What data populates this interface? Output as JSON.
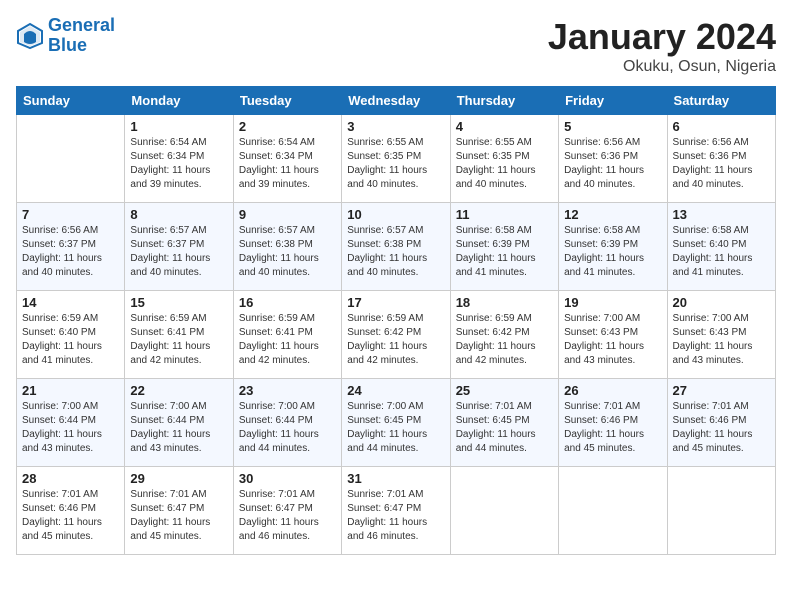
{
  "header": {
    "logo_line1": "General",
    "logo_line2": "Blue",
    "month_year": "January 2024",
    "location": "Okuku, Osun, Nigeria"
  },
  "weekdays": [
    "Sunday",
    "Monday",
    "Tuesday",
    "Wednesday",
    "Thursday",
    "Friday",
    "Saturday"
  ],
  "weeks": [
    [
      {
        "day": "",
        "sunrise": "",
        "sunset": "",
        "daylight": ""
      },
      {
        "day": "1",
        "sunrise": "Sunrise: 6:54 AM",
        "sunset": "Sunset: 6:34 PM",
        "daylight": "Daylight: 11 hours and 39 minutes."
      },
      {
        "day": "2",
        "sunrise": "Sunrise: 6:54 AM",
        "sunset": "Sunset: 6:34 PM",
        "daylight": "Daylight: 11 hours and 39 minutes."
      },
      {
        "day": "3",
        "sunrise": "Sunrise: 6:55 AM",
        "sunset": "Sunset: 6:35 PM",
        "daylight": "Daylight: 11 hours and 40 minutes."
      },
      {
        "day": "4",
        "sunrise": "Sunrise: 6:55 AM",
        "sunset": "Sunset: 6:35 PM",
        "daylight": "Daylight: 11 hours and 40 minutes."
      },
      {
        "day": "5",
        "sunrise": "Sunrise: 6:56 AM",
        "sunset": "Sunset: 6:36 PM",
        "daylight": "Daylight: 11 hours and 40 minutes."
      },
      {
        "day": "6",
        "sunrise": "Sunrise: 6:56 AM",
        "sunset": "Sunset: 6:36 PM",
        "daylight": "Daylight: 11 hours and 40 minutes."
      }
    ],
    [
      {
        "day": "7",
        "sunrise": "Sunrise: 6:56 AM",
        "sunset": "Sunset: 6:37 PM",
        "daylight": "Daylight: 11 hours and 40 minutes."
      },
      {
        "day": "8",
        "sunrise": "Sunrise: 6:57 AM",
        "sunset": "Sunset: 6:37 PM",
        "daylight": "Daylight: 11 hours and 40 minutes."
      },
      {
        "day": "9",
        "sunrise": "Sunrise: 6:57 AM",
        "sunset": "Sunset: 6:38 PM",
        "daylight": "Daylight: 11 hours and 40 minutes."
      },
      {
        "day": "10",
        "sunrise": "Sunrise: 6:57 AM",
        "sunset": "Sunset: 6:38 PM",
        "daylight": "Daylight: 11 hours and 40 minutes."
      },
      {
        "day": "11",
        "sunrise": "Sunrise: 6:58 AM",
        "sunset": "Sunset: 6:39 PM",
        "daylight": "Daylight: 11 hours and 41 minutes."
      },
      {
        "day": "12",
        "sunrise": "Sunrise: 6:58 AM",
        "sunset": "Sunset: 6:39 PM",
        "daylight": "Daylight: 11 hours and 41 minutes."
      },
      {
        "day": "13",
        "sunrise": "Sunrise: 6:58 AM",
        "sunset": "Sunset: 6:40 PM",
        "daylight": "Daylight: 11 hours and 41 minutes."
      }
    ],
    [
      {
        "day": "14",
        "sunrise": "Sunrise: 6:59 AM",
        "sunset": "Sunset: 6:40 PM",
        "daylight": "Daylight: 11 hours and 41 minutes."
      },
      {
        "day": "15",
        "sunrise": "Sunrise: 6:59 AM",
        "sunset": "Sunset: 6:41 PM",
        "daylight": "Daylight: 11 hours and 42 minutes."
      },
      {
        "day": "16",
        "sunrise": "Sunrise: 6:59 AM",
        "sunset": "Sunset: 6:41 PM",
        "daylight": "Daylight: 11 hours and 42 minutes."
      },
      {
        "day": "17",
        "sunrise": "Sunrise: 6:59 AM",
        "sunset": "Sunset: 6:42 PM",
        "daylight": "Daylight: 11 hours and 42 minutes."
      },
      {
        "day": "18",
        "sunrise": "Sunrise: 6:59 AM",
        "sunset": "Sunset: 6:42 PM",
        "daylight": "Daylight: 11 hours and 42 minutes."
      },
      {
        "day": "19",
        "sunrise": "Sunrise: 7:00 AM",
        "sunset": "Sunset: 6:43 PM",
        "daylight": "Daylight: 11 hours and 43 minutes."
      },
      {
        "day": "20",
        "sunrise": "Sunrise: 7:00 AM",
        "sunset": "Sunset: 6:43 PM",
        "daylight": "Daylight: 11 hours and 43 minutes."
      }
    ],
    [
      {
        "day": "21",
        "sunrise": "Sunrise: 7:00 AM",
        "sunset": "Sunset: 6:44 PM",
        "daylight": "Daylight: 11 hours and 43 minutes."
      },
      {
        "day": "22",
        "sunrise": "Sunrise: 7:00 AM",
        "sunset": "Sunset: 6:44 PM",
        "daylight": "Daylight: 11 hours and 43 minutes."
      },
      {
        "day": "23",
        "sunrise": "Sunrise: 7:00 AM",
        "sunset": "Sunset: 6:44 PM",
        "daylight": "Daylight: 11 hours and 44 minutes."
      },
      {
        "day": "24",
        "sunrise": "Sunrise: 7:00 AM",
        "sunset": "Sunset: 6:45 PM",
        "daylight": "Daylight: 11 hours and 44 minutes."
      },
      {
        "day": "25",
        "sunrise": "Sunrise: 7:01 AM",
        "sunset": "Sunset: 6:45 PM",
        "daylight": "Daylight: 11 hours and 44 minutes."
      },
      {
        "day": "26",
        "sunrise": "Sunrise: 7:01 AM",
        "sunset": "Sunset: 6:46 PM",
        "daylight": "Daylight: 11 hours and 45 minutes."
      },
      {
        "day": "27",
        "sunrise": "Sunrise: 7:01 AM",
        "sunset": "Sunset: 6:46 PM",
        "daylight": "Daylight: 11 hours and 45 minutes."
      }
    ],
    [
      {
        "day": "28",
        "sunrise": "Sunrise: 7:01 AM",
        "sunset": "Sunset: 6:46 PM",
        "daylight": "Daylight: 11 hours and 45 minutes."
      },
      {
        "day": "29",
        "sunrise": "Sunrise: 7:01 AM",
        "sunset": "Sunset: 6:47 PM",
        "daylight": "Daylight: 11 hours and 45 minutes."
      },
      {
        "day": "30",
        "sunrise": "Sunrise: 7:01 AM",
        "sunset": "Sunset: 6:47 PM",
        "daylight": "Daylight: 11 hours and 46 minutes."
      },
      {
        "day": "31",
        "sunrise": "Sunrise: 7:01 AM",
        "sunset": "Sunset: 6:47 PM",
        "daylight": "Daylight: 11 hours and 46 minutes."
      },
      {
        "day": "",
        "sunrise": "",
        "sunset": "",
        "daylight": ""
      },
      {
        "day": "",
        "sunrise": "",
        "sunset": "",
        "daylight": ""
      },
      {
        "day": "",
        "sunrise": "",
        "sunset": "",
        "daylight": ""
      }
    ]
  ]
}
